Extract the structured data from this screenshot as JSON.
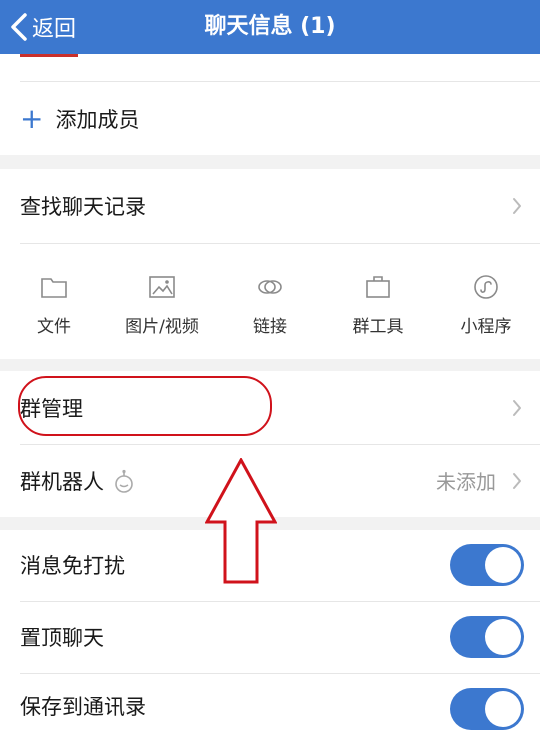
{
  "nav": {
    "back_label": "返回",
    "title": "聊天信息 (1)"
  },
  "members": {
    "add_label": "添加成员"
  },
  "search_history": {
    "label": "查找聊天记录"
  },
  "tools": [
    {
      "label": "文件",
      "icon": "folder-icon"
    },
    {
      "label": "图片/视频",
      "icon": "image-icon"
    },
    {
      "label": "链接",
      "icon": "link-icon"
    },
    {
      "label": "群工具",
      "icon": "toolbox-icon"
    },
    {
      "label": "小程序",
      "icon": "mini-program-icon"
    }
  ],
  "group_manage": {
    "label": "群管理"
  },
  "group_bot": {
    "label": "群机器人",
    "value": "未添加"
  },
  "toggles": [
    {
      "label": "消息免打扰",
      "on": true
    },
    {
      "label": "置顶聊天",
      "on": true
    },
    {
      "label": "保存到通讯录",
      "on": true
    }
  ],
  "colors": {
    "nav": "#3c78cf",
    "toggle_on": "#3c78cf",
    "annotation": "#d0121b"
  }
}
